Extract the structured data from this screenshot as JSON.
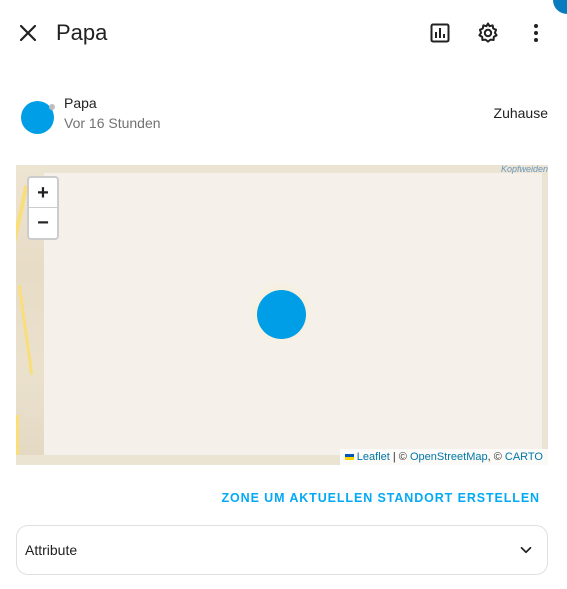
{
  "header": {
    "title": "Papa",
    "icons": {
      "close": "close-icon",
      "history": "chart-box-icon",
      "settings": "gear-icon",
      "more": "more-vertical-icon"
    }
  },
  "entity": {
    "name": "Papa",
    "last_changed": "Vor 16 Stunden",
    "state": "Zuhause",
    "avatar_color": "#009ee6"
  },
  "map": {
    "zoom_in_label": "+",
    "zoom_out_label": "−",
    "place_label": "Kopfweiden",
    "attribution": {
      "leaflet": "Leaflet",
      "separator": " | © ",
      "osm": "OpenStreetMap",
      "middle": ", © ",
      "carto": "CARTO"
    },
    "marker_color": "#009ee6"
  },
  "actions": {
    "zone_button": "Zone um aktuellen Standort erstellen"
  },
  "attributes": {
    "label": "Attribute"
  },
  "colors": {
    "accent": "#03a9f4",
    "text_primary": "#212121",
    "text_secondary": "#727272"
  }
}
